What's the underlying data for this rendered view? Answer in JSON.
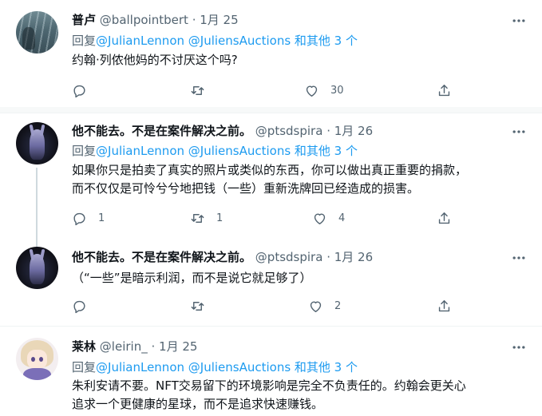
{
  "tweets": [
    {
      "name": "普卢",
      "handle": "@ballpointbert",
      "dot": "·",
      "date": "1月 25",
      "reply_prefix": "回复",
      "reply_links": "@JulianLennon @JuliensAuctions 和其他 3 个",
      "text": "约翰·列侬他妈的不讨厌这个吗?",
      "replies": "",
      "retweets": "",
      "likes": "30"
    },
    {
      "name": "他不能去。不是在案件解决之前。",
      "handle": "@ptsdspira",
      "dot": "·",
      "date": "1月 26",
      "reply_prefix": "回复",
      "reply_links": "@JulianLennon @JuliensAuctions 和其他 3 个",
      "text": "如果你只是拍卖了真实的照片或类似的东西，你可以做出真正重要的捐款，\n而不仅仅是可怜兮兮地把钱（一些）重新洗牌回已经造成的损害。",
      "replies": "1",
      "retweets": "1",
      "likes": "4"
    },
    {
      "name": "他不能去。不是在案件解决之前。",
      "handle": "@ptsdspira",
      "dot": "·",
      "date": "1月 26",
      "text": "（“一些”是暗示利润，而不是说它就足够了）",
      "replies": "",
      "retweets": "",
      "likes": "2"
    },
    {
      "name": "莱林",
      "handle": "@leirin_",
      "dot": "·",
      "date": "1月 25",
      "reply_prefix": "回复",
      "reply_links": "@JulianLennon @JuliensAuctions 和其他 3 个",
      "text": "朱利安请不要。NFT交易留下的环境影响是完全不负责任的。约翰会更关心\n追求一个更健康的星球，而不是追求快速赚钱。"
    }
  ],
  "colors": {
    "accent": "#1d9bf0",
    "muted": "#536471",
    "text": "#0f1419"
  }
}
